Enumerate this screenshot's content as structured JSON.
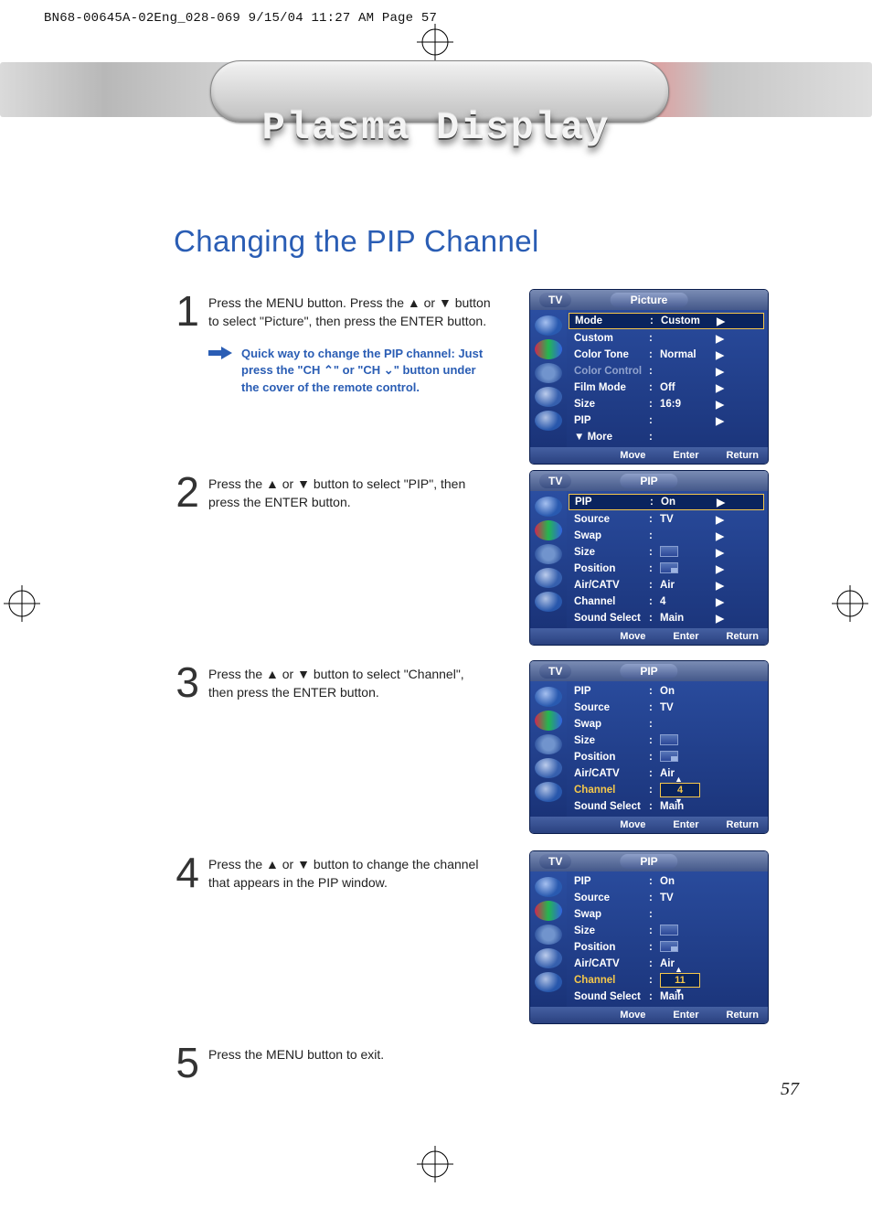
{
  "slug": "BN68-00645A-02Eng_028-069  9/15/04  11:27 AM  Page 57",
  "banner_title": "Plasma Display",
  "heading": "Changing the PIP Channel",
  "steps": [
    {
      "text": "Press the MENU button. Press the ▲ or ▼ button to select \"Picture\", then press the ENTER button."
    },
    {
      "text": "Press the ▲ or ▼ button to select \"PIP\", then press the ENTER button."
    },
    {
      "text": "Press the ▲ or ▼ button to select \"Channel\", then press the ENTER button."
    },
    {
      "text": "Press the ▲ or ▼ button to change the channel that appears in the PIP window."
    },
    {
      "text": "Press the MENU button to exit."
    }
  ],
  "tip": "Quick way to change the PIP channel: Just press the \"CH ⌃\" or \"CH ⌄\" button under the cover of the remote control.",
  "footer": {
    "move": "Move",
    "enter": "Enter",
    "return": "Return"
  },
  "osd_tv": "TV",
  "osd1": {
    "title": "Picture",
    "rows": [
      {
        "label": "Mode",
        "val": "Custom",
        "arr": true,
        "sel": true
      },
      {
        "label": "Custom",
        "val": "",
        "arr": true
      },
      {
        "label": "Color Tone",
        "val": "Normal",
        "arr": true
      },
      {
        "label": "Color Control",
        "val": "",
        "arr": true,
        "dim": true
      },
      {
        "label": "Film Mode",
        "val": "Off",
        "arr": true
      },
      {
        "label": "Size",
        "val": "16:9",
        "arr": true
      },
      {
        "label": "PIP",
        "val": "",
        "arr": true
      },
      {
        "label": "▼ More",
        "val": "",
        "arr": false
      }
    ]
  },
  "osd2": {
    "title": "PIP",
    "rows": [
      {
        "label": "PIP",
        "val": "On",
        "arr": true,
        "sel": true
      },
      {
        "label": "Source",
        "val": "TV",
        "arr": true
      },
      {
        "label": "Swap",
        "val": "",
        "arr": true
      },
      {
        "label": "Size",
        "icon": "size",
        "arr": true
      },
      {
        "label": "Position",
        "icon": "pos",
        "arr": true
      },
      {
        "label": "Air/CATV",
        "val": "Air",
        "arr": true
      },
      {
        "label": "Channel",
        "val": "4",
        "arr": true
      },
      {
        "label": "Sound Select",
        "val": "Main",
        "arr": true
      }
    ]
  },
  "osd3": {
    "title": "PIP",
    "rows": [
      {
        "label": "PIP",
        "val": "On"
      },
      {
        "label": "Source",
        "val": "TV"
      },
      {
        "label": "Swap",
        "val": ""
      },
      {
        "label": "Size",
        "icon": "size"
      },
      {
        "label": "Position",
        "icon": "pos"
      },
      {
        "label": "Air/CATV",
        "val": "Air"
      },
      {
        "label": "Channel",
        "step": "4",
        "orange": true
      },
      {
        "label": "Sound Select",
        "val": "Main"
      }
    ]
  },
  "osd4": {
    "title": "PIP",
    "rows": [
      {
        "label": "PIP",
        "val": "On"
      },
      {
        "label": "Source",
        "val": "TV"
      },
      {
        "label": "Swap",
        "val": ""
      },
      {
        "label": "Size",
        "icon": "size"
      },
      {
        "label": "Position",
        "icon": "pos"
      },
      {
        "label": "Air/CATV",
        "val": "Air"
      },
      {
        "label": "Channel",
        "step": "11",
        "orange": true
      },
      {
        "label": "Sound Select",
        "val": "Main"
      }
    ]
  },
  "page_number": "57"
}
